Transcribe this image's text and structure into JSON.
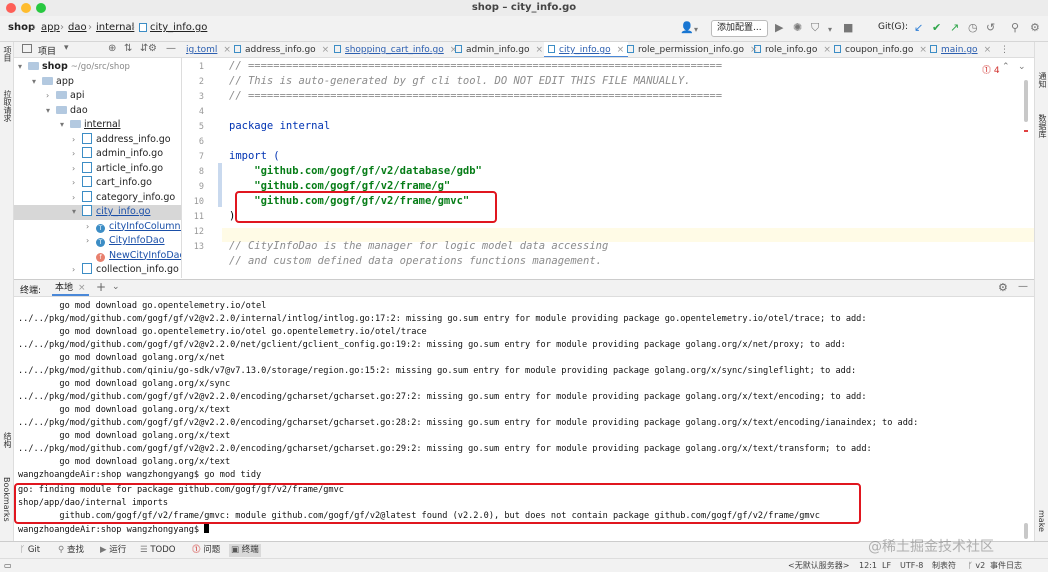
{
  "window": {
    "title": "shop – city_info.go"
  },
  "colors": {
    "close": "#fe5f57",
    "minimize": "#febc2e",
    "maximize": "#28c840",
    "highlight_box": "#e0161f",
    "accent": "#4a88d8"
  },
  "navbar": {
    "breadcrumbs": [
      "shop",
      "app",
      "dao",
      "internal",
      "city_info.go"
    ],
    "add_config_label": "添加配置...",
    "git_label": "Git(G):"
  },
  "left_strip": {
    "project": "项目",
    "pull_requests": "拉取请求",
    "structure": "结构",
    "bookmarks": "Bookmarks"
  },
  "right_strip": {
    "notifications": "通知",
    "database": "数据库",
    "make": "make"
  },
  "project_panel": {
    "title": "项目",
    "tree": [
      {
        "label": "shop",
        "path": "~/go/src/shop"
      },
      {
        "label": "app"
      },
      {
        "label": "api"
      },
      {
        "label": "dao"
      },
      {
        "label": "internal"
      },
      {
        "label": "address_info.go"
      },
      {
        "label": "admin_info.go"
      },
      {
        "label": "article_info.go"
      },
      {
        "label": "cart_info.go"
      },
      {
        "label": "category_info.go"
      },
      {
        "label": "city_info.go"
      },
      {
        "label": "cityInfoColumns"
      },
      {
        "label": "CityInfoDao"
      },
      {
        "label": "NewCityInfoDao"
      },
      {
        "label": "collection_info.go"
      }
    ]
  },
  "editor_tabs": [
    "ig.toml",
    "address_info.go",
    "shopping_cart_info.go",
    "admin_info.go",
    "city_info.go",
    "role_permission_info.go",
    "role_info.go",
    "coupon_info.go",
    "main.go"
  ],
  "editor": {
    "error_count": "4",
    "line_numbers": [
      "1",
      "2",
      "3",
      "4",
      "5",
      "6",
      "7",
      "8",
      "9",
      "10",
      "11",
      "12",
      "13"
    ],
    "lines": [
      "// ===========================================================================",
      "// This is auto-generated by gf cli tool. DO NOT EDIT THIS FILE MANUALLY.",
      "// ===========================================================================",
      "",
      "package internal",
      "",
      "import (",
      "    \"github.com/gogf/gf/v2/database/gdb\"",
      "    \"github.com/gogf/gf/v2/frame/g\"",
      "    \"github.com/gogf/gf/v2/frame/gmvc\"",
      ")",
      "",
      "// CityInfoDao is the manager for logic model data accessing",
      "// and custom defined data operations functions management."
    ]
  },
  "terminal": {
    "title": "终端:",
    "tab": "本地",
    "lines": [
      "        go mod download go.opentelemetry.io/otel",
      "../../pkg/mod/github.com/gogf/gf/v2@v2.2.0/internal/intlog/intlog.go:17:2: missing go.sum entry for module providing package go.opentelemetry.io/otel/trace; to add:",
      "        go mod download go.opentelemetry.io/otel go.opentelemetry.io/otel/trace",
      "../../pkg/mod/github.com/gogf/gf/v2@v2.2.0/net/gclient/gclient_config.go:19:2: missing go.sum entry for module providing package golang.org/x/net/proxy; to add:",
      "        go mod download golang.org/x/net",
      "../../pkg/mod/github.com/qiniu/go-sdk/v7@v7.13.0/storage/region.go:15:2: missing go.sum entry for module providing package golang.org/x/sync/singleflight; to add:",
      "        go mod download golang.org/x/sync",
      "../../pkg/mod/github.com/gogf/gf/v2@v2.2.0/encoding/gcharset/gcharset.go:27:2: missing go.sum entry for module providing package golang.org/x/text/encoding; to add:",
      "        go mod download golang.org/x/text",
      "../../pkg/mod/github.com/gogf/gf/v2@v2.2.0/encoding/gcharset/gcharset.go:28:2: missing go.sum entry for module providing package golang.org/x/text/encoding/ianaindex; to add:",
      "        go mod download golang.org/x/text",
      "../../pkg/mod/github.com/gogf/gf/v2@v2.2.0/encoding/gcharset/gcharset.go:29:2: missing go.sum entry for module providing package golang.org/x/text/transform; to add:",
      "        go mod download golang.org/x/text",
      "wangzhoangdeAir:shop wangzhongyang$ go mod tidy",
      "go: finding module for package github.com/gogf/gf/v2/frame/gmvc",
      "shop/app/dao/internal imports",
      "        github.com/gogf/gf/v2/frame/gmvc: module github.com/gogf/gf/v2@latest found (v2.2.0), but does not contain package github.com/gogf/gf/v2/frame/gmvc",
      "wangzhoangdeAir:shop wangzhongyang$ "
    ]
  },
  "bottom_tabs": [
    "Git",
    "查找",
    "运行",
    "TODO",
    "问题",
    "终端"
  ],
  "status_bar": {
    "server": "<无默认服务器>",
    "position": "12:1",
    "line_sep": "LF",
    "encoding": "UTF-8",
    "indent": "制表符",
    "branch": "v2",
    "event_log": "事件日志"
  },
  "watermark": "@稀土掘金技术社区"
}
